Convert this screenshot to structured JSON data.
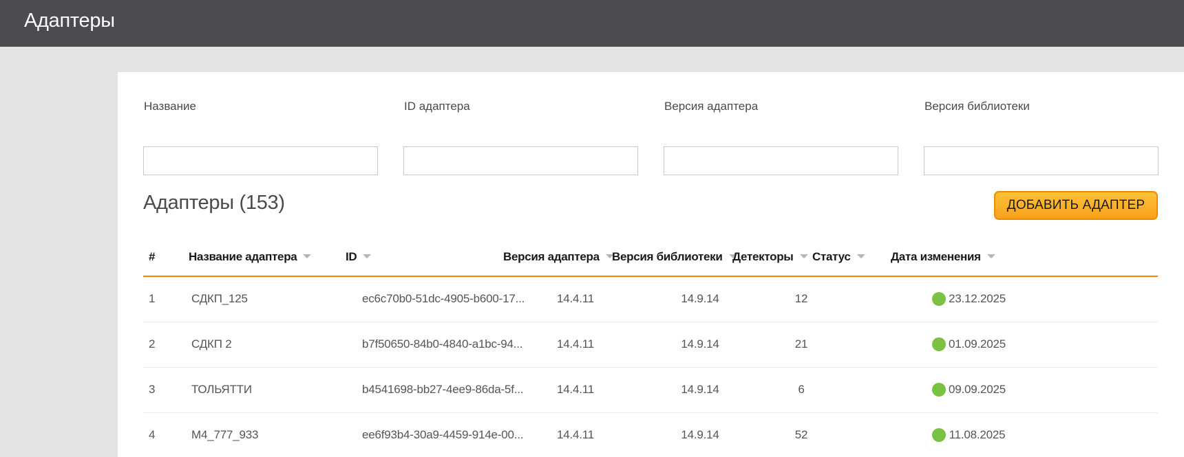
{
  "header": {
    "title": "Адаптеры"
  },
  "filters": [
    {
      "label": "Название",
      "value": ""
    },
    {
      "label": "ID адаптера",
      "value": ""
    },
    {
      "label": "Версия адаптера",
      "value": ""
    },
    {
      "label": "Версия библиотеки",
      "value": ""
    }
  ],
  "section": {
    "title": "Адаптеры (153)",
    "add_button": "ДОБАВИТЬ АДАПТЕР"
  },
  "columns": [
    "#",
    "Название адаптера",
    "ID",
    "Версия адаптера",
    "Версия библиотеки",
    "Детекторы",
    "Статус",
    "Дата изменения"
  ],
  "rows": [
    {
      "num": "1",
      "name": "СДКП_125",
      "id": "ec6c70b0-51dc-4905-b600-17...",
      "version": "14.4.11",
      "library": "14.9.14",
      "detectors": "12",
      "status": "active",
      "date": "23.12.2025"
    },
    {
      "num": "2",
      "name": "СДКП 2",
      "id": "b7f50650-84b0-4840-a1bc-94...",
      "version": "14.4.11",
      "library": "14.9.14",
      "detectors": "21",
      "status": "active",
      "date": "01.09.2025"
    },
    {
      "num": "3",
      "name": "ТОЛЬЯТТИ",
      "id": "b4541698-bb27-4ee9-86da-5f...",
      "version": "14.4.11",
      "library": "14.9.14",
      "detectors": "6",
      "status": "active",
      "date": "09.09.2025"
    },
    {
      "num": "4",
      "name": "M4_777_933",
      "id": "ee6f93b4-30a9-4459-914e-00...",
      "version": "14.4.11",
      "library": "14.9.14",
      "detectors": "52",
      "status": "active",
      "date": "11.08.2025"
    }
  ],
  "colors": {
    "topbar": "#4a4c51",
    "accent": "#f08a00",
    "button": "#f7a11c",
    "status_active": "#7bc142"
  }
}
